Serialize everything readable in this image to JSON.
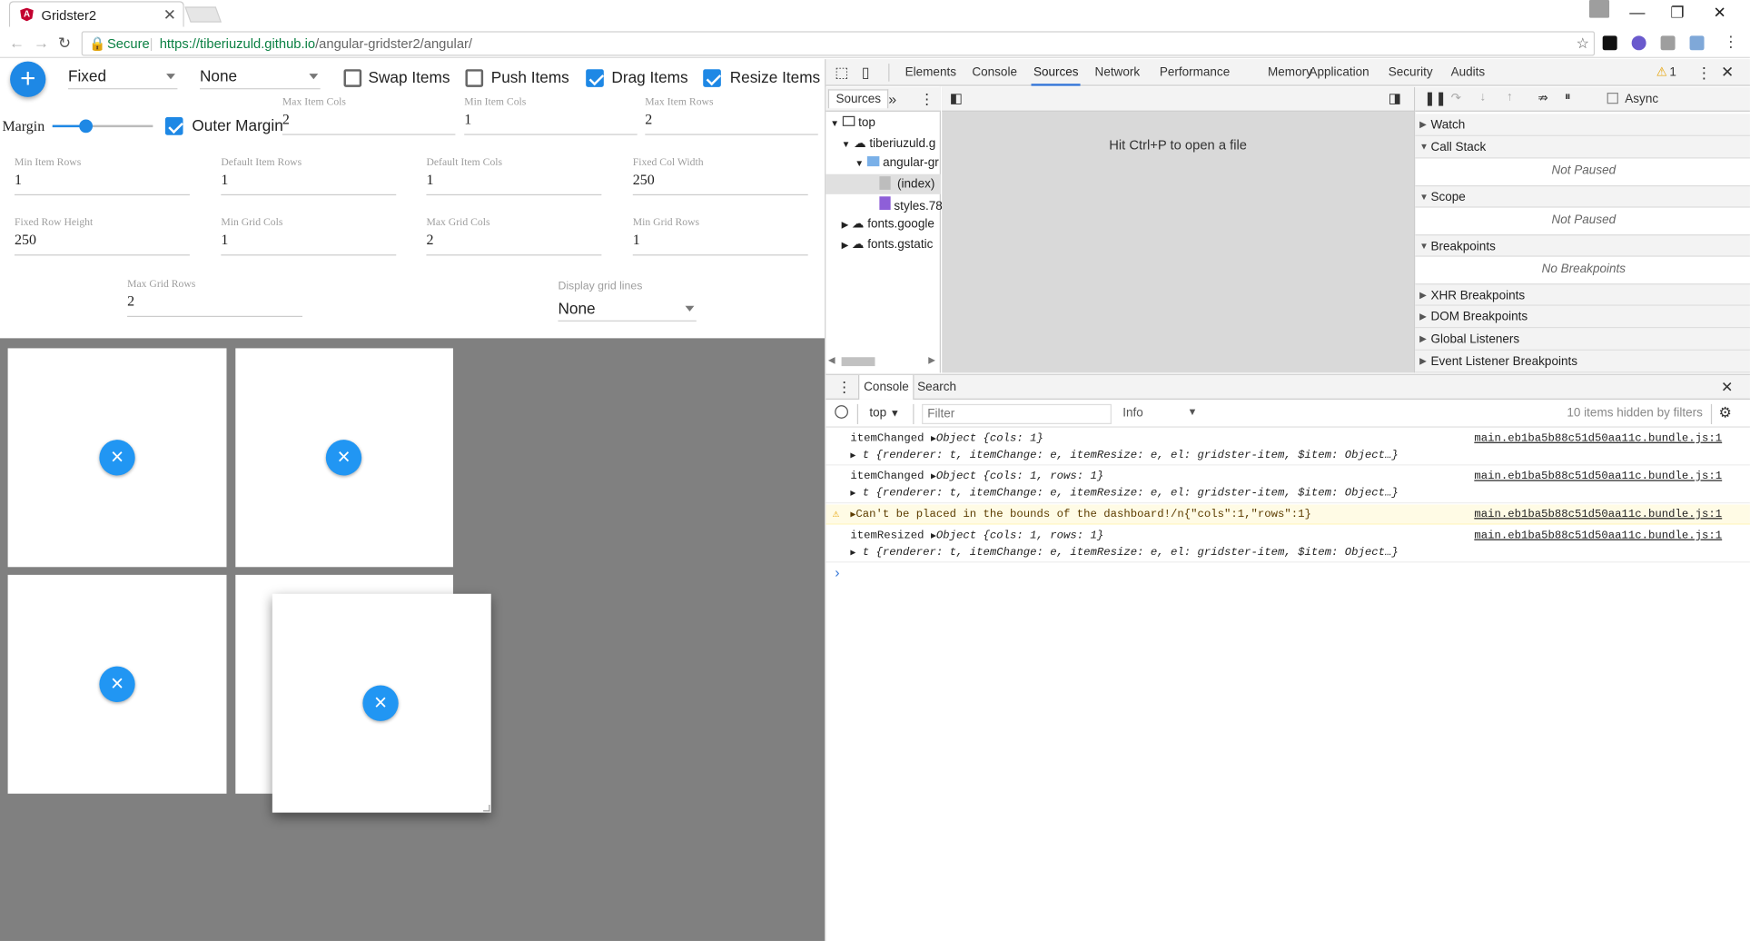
{
  "browser": {
    "tab_title": "Gridster2",
    "secure_label": "Secure",
    "url_host": "https://tiberiuzuld.github.io",
    "url_path": "/angular-gridster2/angular/"
  },
  "toolbar": {
    "add_label": "+",
    "grid_type": "Fixed",
    "compact_type": "None",
    "swap_label": "Swap Items",
    "push_label": "Push Items",
    "drag_label": "Drag Items",
    "resize_label": "Resize Items",
    "margin_label": "Margin",
    "outer_margin_label": "Outer Margin",
    "swap_checked": false,
    "push_checked": false,
    "drag_checked": true,
    "resize_checked": true,
    "outer_margin_checked": true
  },
  "fields": [
    {
      "label": "Max Item Cols",
      "value": "2"
    },
    {
      "label": "Min Item Cols",
      "value": "1"
    },
    {
      "label": "Max Item Rows",
      "value": "2"
    },
    {
      "label": "Min Item Rows",
      "value": "1"
    },
    {
      "label": "Default Item Rows",
      "value": "1"
    },
    {
      "label": "Default Item Cols",
      "value": "1"
    },
    {
      "label": "Fixed Col Width",
      "value": "250"
    },
    {
      "label": "Fixed Row Height",
      "value": "250"
    },
    {
      "label": "Min Grid Cols",
      "value": "1"
    },
    {
      "label": "Max Grid Cols",
      "value": "2"
    },
    {
      "label": "Min Grid Rows",
      "value": "1"
    },
    {
      "label": "Max Grid Rows",
      "value": "2"
    }
  ],
  "display_grid": {
    "label": "Display grid lines",
    "value": "None"
  },
  "grid_items": [
    {
      "close": "×"
    },
    {
      "close": "×"
    },
    {
      "close": "×"
    },
    {
      "close": "×"
    }
  ],
  "devtools": {
    "tabs": [
      "Elements",
      "Console",
      "Sources",
      "Network",
      "Performance",
      "Memory",
      "Application",
      "Security",
      "Audits"
    ],
    "active_tab": "Sources",
    "warning_count": "1",
    "navigator": {
      "header": "Sources",
      "tree": [
        "top",
        "tiberiuzuld.g",
        "angular-gr",
        "(index)",
        "styles.78",
        "fonts.google",
        "fonts.gstatic"
      ]
    },
    "editor_hint": "Hit Ctrl+P to open a file",
    "async_label": "Async",
    "sections": [
      {
        "title": "Watch",
        "note": ""
      },
      {
        "title": "Call Stack",
        "note": "Not Paused"
      },
      {
        "title": "Scope",
        "note": "Not Paused"
      },
      {
        "title": "Breakpoints",
        "note": "No Breakpoints"
      },
      {
        "title": "XHR Breakpoints",
        "note": ""
      },
      {
        "title": "DOM Breakpoints",
        "note": ""
      },
      {
        "title": "Global Listeners",
        "note": ""
      },
      {
        "title": "Event Listener Breakpoints",
        "note": ""
      }
    ],
    "console": {
      "tabs": [
        "Console",
        "Search"
      ],
      "context": "top",
      "filter_placeholder": "Filter",
      "level": "Info",
      "hidden_info": "10 items hidden by filters",
      "messages": [
        {
          "name": "itemChanged",
          "obj": "Object {cols: 1}",
          "detail": "t {renderer: t, itemChange: e, itemResize: e, el: gridster-item, $item: Object…}",
          "source": "main.eb1ba5b88c51d50aa11c.bundle.js:1"
        },
        {
          "name": "itemChanged",
          "obj": "Object {cols: 1, rows: 1}",
          "detail": "t {renderer: t, itemChange: e, itemResize: e, el: gridster-item, $item: Object…}",
          "source": "main.eb1ba5b88c51d50aa11c.bundle.js:1"
        },
        {
          "warn": "Can't be placed in the bounds of the dashboard!/n{\"cols\":1,\"rows\":1}",
          "source": "main.eb1ba5b88c51d50aa11c.bundle.js:1"
        },
        {
          "name": "itemResized",
          "obj": "Object {cols: 1, rows: 1}",
          "detail": "t {renderer: t, itemChange: e, itemResize: e, el: gridster-item, $item: Object…}",
          "source": "main.eb1ba5b88c51d50aa11c.bundle.js:1"
        }
      ],
      "prompt": "›"
    }
  },
  "colors": {
    "accent": "#1e88e5",
    "grid_bg": "#808080",
    "devtools_active": "#3879d9"
  }
}
